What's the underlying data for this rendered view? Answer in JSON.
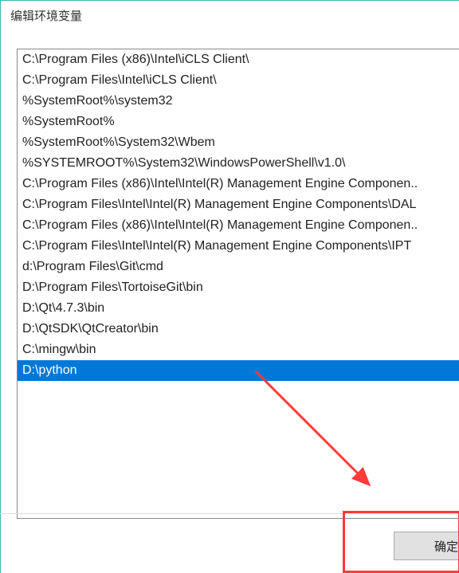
{
  "window": {
    "title": "编辑环境变量"
  },
  "path_list": {
    "items": [
      "C:\\Program Files (x86)\\Intel\\iCLS Client\\",
      "C:\\Program Files\\Intel\\iCLS Client\\",
      "%SystemRoot%\\system32",
      "%SystemRoot%",
      "%SystemRoot%\\System32\\Wbem",
      "%SYSTEMROOT%\\System32\\WindowsPowerShell\\v1.0\\",
      "C:\\Program Files (x86)\\Intel\\Intel(R) Management Engine Componen..",
      "C:\\Program Files\\Intel\\Intel(R) Management Engine Components\\DAL",
      "C:\\Program Files (x86)\\Intel\\Intel(R) Management Engine Componen..",
      "C:\\Program Files\\Intel\\Intel(R) Management Engine Components\\IPT",
      "d:\\Program Files\\Git\\cmd",
      "D:\\Program Files\\TortoiseGit\\bin",
      "D:\\Qt\\4.7.3\\bin",
      "D:\\QtSDK\\QtCreator\\bin",
      "C:\\mingw\\bin",
      "D:\\python"
    ],
    "selected_index": 15
  },
  "buttons": {
    "ok_label": "确定"
  },
  "annotation": {
    "highlight_color": "#ff3b3b",
    "arrow_color": "#ff3b3b"
  }
}
